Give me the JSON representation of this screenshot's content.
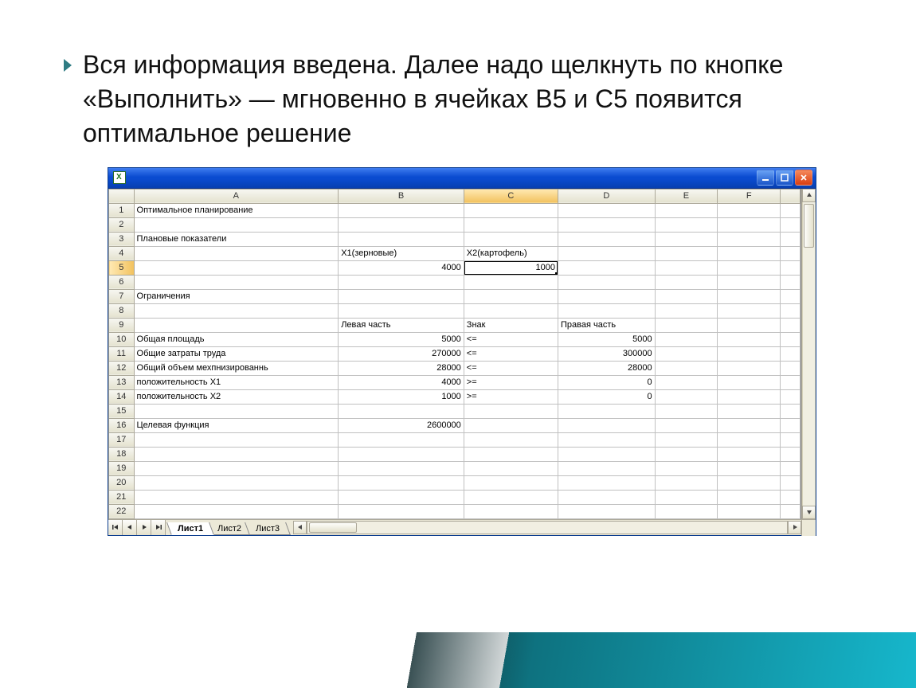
{
  "bullet": "Вся информация введена. Далее надо щелкнуть по кнопке «Выполнить» — мгновенно в ячейках B5 и C5 появится оптимальное решение",
  "columns": [
    "A",
    "B",
    "C",
    "D",
    "E",
    "F"
  ],
  "rows_visible": 22,
  "active_cell": "C5",
  "tabs": {
    "items": [
      "Лист1",
      "Лист2",
      "Лист3"
    ],
    "active": 0
  },
  "cells": {
    "r1": {
      "A": "Оптимальное планирование"
    },
    "r3": {
      "A": "Плановые показатели"
    },
    "r4": {
      "B": "X1(зерновые)",
      "C": "X2(картофель)"
    },
    "r5": {
      "B": "4000",
      "C": "1000"
    },
    "r7": {
      "A": "Ограничения"
    },
    "r9": {
      "B": "Левая часть",
      "C": "Знак",
      "D": "Правая часть"
    },
    "r10": {
      "A": "Общая площадь",
      "B": "5000",
      "C": "<=",
      "D": "5000"
    },
    "r11": {
      "A": "Общие затраты труда",
      "B": "270000",
      "C": "<=",
      "D": "300000"
    },
    "r12": {
      "A": "Общий объем мехпнизированнь",
      "B": "28000",
      "C": "<=",
      "D": "28000"
    },
    "r13": {
      "A": "положительность X1",
      "B": "4000",
      "C": ">=",
      "D": "0"
    },
    "r14": {
      "A": "положительность X2",
      "B": "1000",
      "C": ">=",
      "D": "0"
    },
    "r16": {
      "A": "Целевая функция",
      "B": "2600000"
    }
  }
}
